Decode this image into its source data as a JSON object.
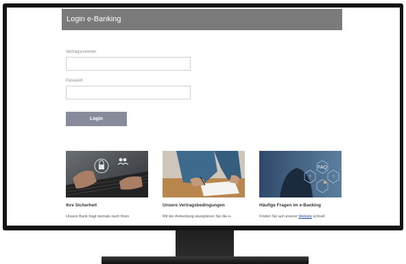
{
  "header": {
    "title": "Login e-Banking"
  },
  "form": {
    "contract_label": "Vertragsnummer",
    "password_label": "Passwort",
    "login_label": "Login"
  },
  "cards": [
    {
      "title": "Ihre Sicherheit",
      "text": "Unsere Bank fragt niemals nach Ihren"
    },
    {
      "title": "Unsere Vertragsbedingungen",
      "text": "Mit der Anmeldung akzeptieren Sie die e-"
    },
    {
      "title": "Häufige Fragen im e-Banking",
      "text_before": "Finden Sie auf unserer ",
      "link": "Website",
      "text_after": " schnell",
      "faq_badge": "FAQ"
    }
  ],
  "colors": {
    "header_bg": "#7a7a7a",
    "button_bg": "#878b9c",
    "link": "#1a4c9c"
  }
}
